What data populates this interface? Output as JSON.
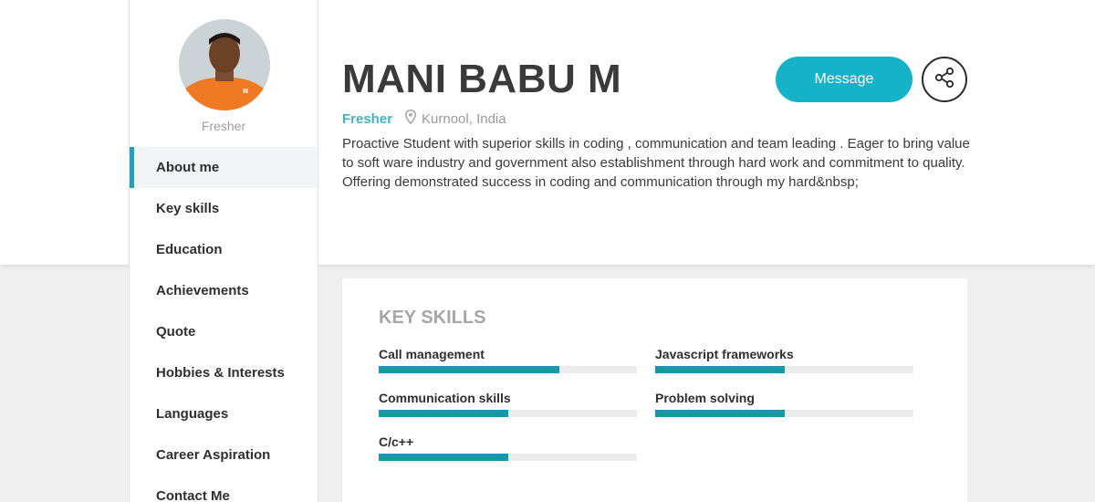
{
  "profile": {
    "name": "MANI BABU M",
    "role": "Fresher",
    "location": "Kurnool, India",
    "bio": "Proactive Student with superior skills in coding , communication and team leading . Eager to bring value to soft ware industry and government also establishment through hard work and commitment to quality. Offering demonstrated success in coding and communication through my hard&nbsp;",
    "avatar_alt": "profile photo"
  },
  "sidebar": {
    "role": "Fresher",
    "items": [
      {
        "label": "About me",
        "active": true
      },
      {
        "label": "Key skills",
        "active": false
      },
      {
        "label": "Education",
        "active": false
      },
      {
        "label": "Achievements",
        "active": false
      },
      {
        "label": "Quote",
        "active": false
      },
      {
        "label": "Hobbies & Interests",
        "active": false
      },
      {
        "label": "Languages",
        "active": false
      },
      {
        "label": "Career Aspiration",
        "active": false
      },
      {
        "label": "Contact Me",
        "active": false
      }
    ]
  },
  "actions": {
    "message_label": "Message",
    "share_icon": "share-icon"
  },
  "key_skills": {
    "title": "KEY SKILLS",
    "skills": [
      {
        "label": "Call management",
        "level": 0.7
      },
      {
        "label": "Javascript frameworks",
        "level": 0.5
      },
      {
        "label": "Communication skills",
        "level": 0.5
      },
      {
        "label": "Problem solving",
        "level": 0.5
      },
      {
        "label": "C/c++",
        "level": 0.5
      }
    ]
  },
  "colors": {
    "accent": "#16b3c8",
    "bar": "#1797aa",
    "track": "#ececec",
    "active_border": "#1fa3b9"
  }
}
